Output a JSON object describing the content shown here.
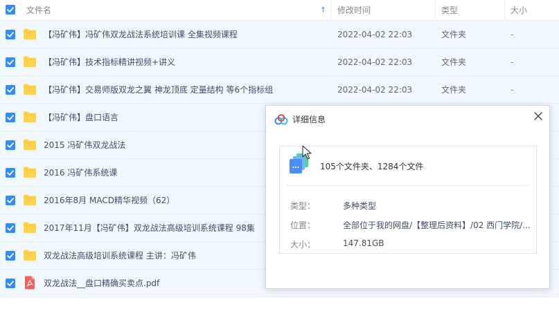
{
  "header": {
    "col_name": "文件名",
    "col_modified": "修改时间",
    "col_type": "类型",
    "col_size": "大小",
    "sort_indicator": "↑"
  },
  "files": [
    {
      "name": "【冯矿伟】冯矿伟双龙战法系统培训课 全集视频课程",
      "modified": "2022-04-02 22:03",
      "type": "文件夹",
      "size": "-",
      "kind": "folder",
      "checked": true
    },
    {
      "name": "【冯矿伟】技术指标精讲视频+讲义",
      "modified": "2022-04-02 22:03",
      "type": "文件夹",
      "size": "-",
      "kind": "folder",
      "checked": true
    },
    {
      "name": "【冯矿伟】交易师版双龙之翼 神龙顶底 定量结构 等6个指标组",
      "modified": "2022-04-02 22:03",
      "type": "文件夹",
      "size": "-",
      "kind": "folder",
      "checked": true
    },
    {
      "name": "【冯矿伟】盘口语言",
      "modified": "",
      "type": "",
      "size": "",
      "kind": "folder",
      "checked": true
    },
    {
      "name": "2015 冯矿伟双龙战法",
      "modified": "",
      "type": "",
      "size": "",
      "kind": "folder",
      "checked": true
    },
    {
      "name": "2016 冯矿伟系统课",
      "modified": "",
      "type": "",
      "size": "",
      "kind": "folder",
      "checked": true
    },
    {
      "name": "2016年8月 MACD精华视频（62）",
      "modified": "",
      "type": "",
      "size": "",
      "kind": "folder",
      "checked": true
    },
    {
      "name": "2017年11月【冯矿伟】双龙战法高级培训系统课程 98集",
      "modified": "",
      "type": "",
      "size": "",
      "kind": "folder",
      "checked": true
    },
    {
      "name": "双龙战法高级培训系统课程 主讲：冯矿伟",
      "modified": "",
      "type": "",
      "size": "",
      "kind": "folder",
      "checked": true
    },
    {
      "name": "双龙战法__盘口精确买卖点.pdf",
      "modified": "",
      "type": "",
      "size": "",
      "kind": "pdf",
      "checked": true
    }
  ],
  "dialog": {
    "title": "详细信息",
    "summary": "105个文件夹、1284个文件",
    "type_label": "类型：",
    "type_value": "多种类型",
    "location_label": "位置：",
    "location_value": "全部位于我的网盘/【整理后资料】/02 西门学院/...",
    "size_label": "大小：",
    "size_value": "147.81GB"
  },
  "colors": {
    "accent": "#2f8cff",
    "row_selected_bg": "#f1f8ff",
    "folder": "#ffd24d",
    "pdf": "#f5605a"
  },
  "icons": {
    "folder": "folder-icon",
    "pdf": "pdf-icon",
    "checkbox": "checkbox-checked-icon",
    "close": "close-icon",
    "cloud": "cloud-logo-icon",
    "multi_files": "multi-file-stack-icon"
  }
}
